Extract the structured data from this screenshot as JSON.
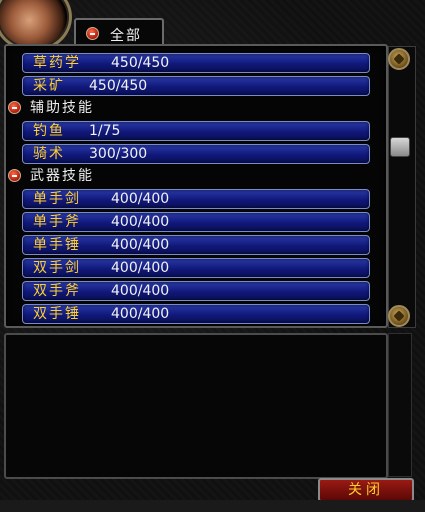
{
  "tab": {
    "label": "全部"
  },
  "rows": [
    {
      "name": "草药学",
      "value": "450/450"
    },
    {
      "name": "采矿",
      "value": "450/450"
    },
    {
      "name": "钓鱼",
      "value": "1/75"
    },
    {
      "name": "骑术",
      "value": "300/300"
    },
    {
      "name": "单手剑",
      "value": "400/400"
    },
    {
      "name": "单手斧",
      "value": "400/400"
    },
    {
      "name": "单手锤",
      "value": "400/400"
    },
    {
      "name": "双手剑",
      "value": "400/400"
    },
    {
      "name": "双手斧",
      "value": "400/400"
    },
    {
      "name": "双手锤",
      "value": "400/400"
    }
  ],
  "headers": {
    "secondary": "辅助技能",
    "weapon": "武器技能"
  },
  "buttons": {
    "close": "关闭"
  },
  "colors": {
    "row_fill": "#10187a",
    "skill_name": "#ffcf2a",
    "close_button": "#7a0f0a"
  }
}
